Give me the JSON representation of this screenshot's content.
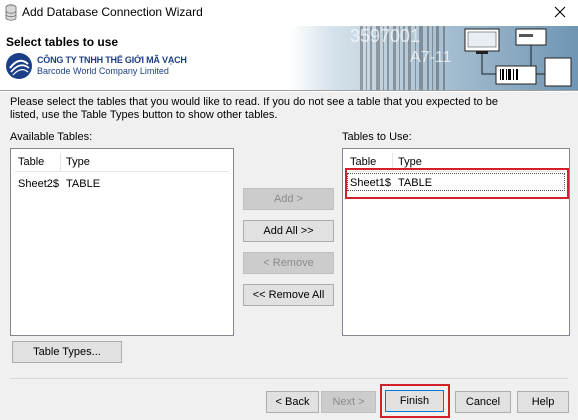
{
  "window": {
    "title": "Add Database Connection Wizard"
  },
  "header": {
    "title": "Select tables to use",
    "brand_line1": "CÔNG TY TNHH THẾ GIỚI MÃ VẠCH",
    "brand_line2": "Barcode World Company Limited",
    "art_text1": "3597001",
    "art_text2": "A7-11"
  },
  "instructions": "Please select the tables that you would like to read.  If you do not see a table that you expected to be listed, use the Table Types button to show other tables.",
  "available": {
    "label": "Available Tables:",
    "columns": [
      "Table",
      "Type"
    ],
    "rows": [
      {
        "table": "Sheet2$",
        "type": "TABLE"
      }
    ]
  },
  "to_use": {
    "label": "Tables to Use:",
    "columns": [
      "Table",
      "Type"
    ],
    "rows": [
      {
        "table": "Sheet1$",
        "type": "TABLE"
      }
    ]
  },
  "buttons": {
    "add": "Add >",
    "add_all": "Add All >>",
    "remove": "< Remove",
    "remove_all": "<< Remove All",
    "table_types": "Table Types...",
    "back": "< Back",
    "next": "Next >",
    "finish": "Finish",
    "cancel": "Cancel",
    "help": "Help"
  },
  "colors": {
    "highlight": "#d3202a",
    "brand": "#1b3f86"
  }
}
